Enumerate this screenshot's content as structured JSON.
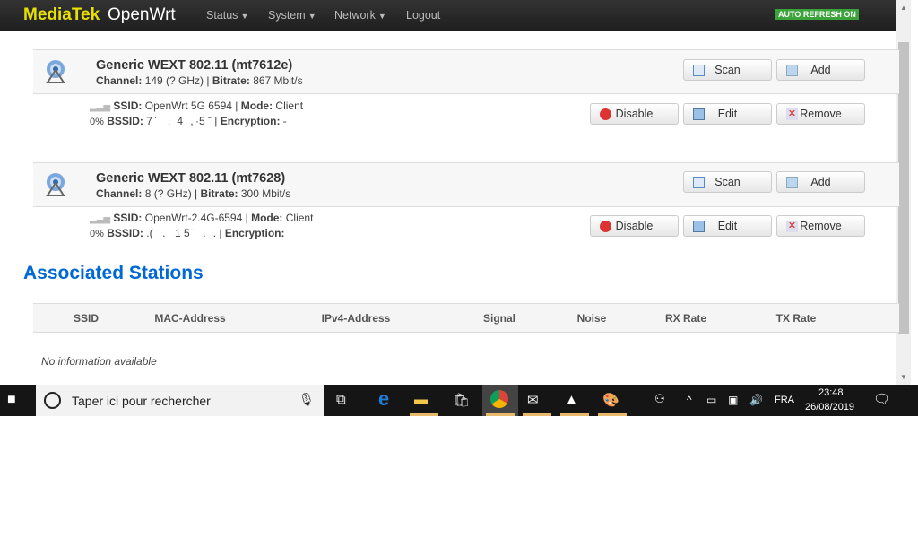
{
  "nav": {
    "brand": "MediaTek",
    "product": "OpenWrt",
    "menus": [
      "Status",
      "System",
      "Network"
    ],
    "logout": "Logout",
    "auto_refresh": "AUTO REFRESH ON"
  },
  "devices": [
    {
      "title": "Generic WEXT 802.11 (mt7612e)",
      "channel_label": "Channel:",
      "channel": "149 (? GHz)",
      "bitrate_label": "Bitrate:",
      "bitrate": "867 Mbit/s",
      "network": {
        "ssid_label": "SSID:",
        "ssid": "OpenWrt 5G 6594",
        "mode_label": "Mode:",
        "mode": "Client",
        "signal": "0%",
        "bssid_label": "BSSID:",
        "bssid": "7 ´    ,   4   , ·5 ˉ",
        "enc_label": "Encryption:",
        "encryption": "-"
      }
    },
    {
      "title": "Generic WEXT 802.11 (mt7628)",
      "channel_label": "Channel:",
      "channel": "8 (? GHz)",
      "bitrate_label": "Bitrate:",
      "bitrate": "300 Mbit/s",
      "network": {
        "ssid_label": "SSID:",
        "ssid": "OpenWrt-2.4G-6594",
        "mode_label": "Mode:",
        "mode": "Client",
        "signal": "0%",
        "bssid_label": "BSSID:",
        "bssid": ".(    .    1 5ˉ    .   .",
        "enc_label": "Encryption:",
        "encryption": ""
      }
    }
  ],
  "buttons": {
    "scan": "Scan",
    "add": "Add",
    "disable": "Disable",
    "edit": "Edit",
    "remove": "Remove"
  },
  "stations": {
    "title": "Associated Stations",
    "columns": [
      "SSID",
      "MAC-Address",
      "IPv4-Address",
      "Signal",
      "Noise",
      "RX Rate",
      "TX Rate"
    ],
    "empty": "No information available"
  },
  "taskbar": {
    "search_placeholder": "Taper ici pour rechercher",
    "lang": "FRA",
    "time": "23:48",
    "date": "26/08/2019"
  }
}
